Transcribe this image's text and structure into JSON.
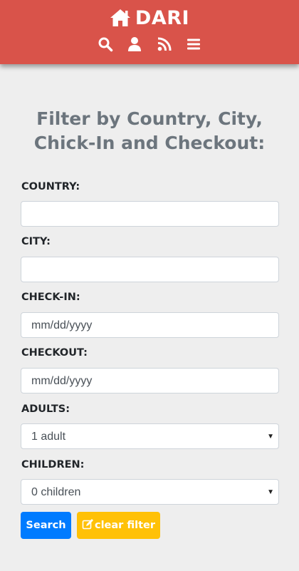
{
  "header": {
    "brand": "DARI",
    "background_color": "#d9534a",
    "icons": [
      "home-icon",
      "search-icon",
      "user-icon",
      "rss-icon",
      "menu-icon"
    ]
  },
  "page": {
    "heading_line1": "Filter by Country, City,",
    "heading_line2": "Chick-In and Checkout:"
  },
  "form": {
    "country": {
      "label": "COUNTRY:",
      "value": ""
    },
    "city": {
      "label": "CITY:",
      "value": ""
    },
    "checkin": {
      "label": "CHECK-IN:",
      "placeholder": "mm/dd/yyyy"
    },
    "checkout": {
      "label": "CHECKOUT:",
      "placeholder": "mm/dd/yyyy"
    },
    "adults": {
      "label": "ADULTS:",
      "selected": "1 adult"
    },
    "children": {
      "label": "CHILDREN:",
      "selected": "0 children"
    }
  },
  "buttons": {
    "search_label": "Search",
    "clear_label": "clear filter",
    "search_color": "#007bff",
    "clear_color": "#ffc107"
  }
}
